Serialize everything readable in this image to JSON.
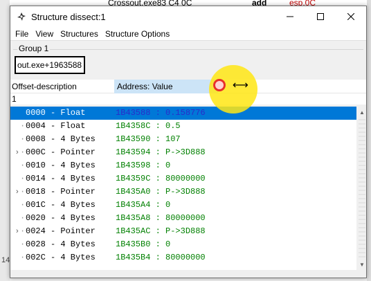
{
  "background": {
    "top_text_1": "Crossout.exe83 C4 0C",
    "top_text_2": "add",
    "top_text_3": "esp,0C",
    "left_text": "14"
  },
  "window": {
    "title": "Structure dissect:1",
    "icon": "cheat-engine-icon",
    "minimize_icon": "minimize-icon",
    "maximize_icon": "maximize-icon",
    "close_icon": "close-icon"
  },
  "menu": {
    "items": [
      "File",
      "View",
      "Structures",
      "Structure Options"
    ]
  },
  "group": {
    "label": "Group 1",
    "address": "out.exe+1963588"
  },
  "header": {
    "offset_description": "Offset-description",
    "address_value": "Address: Value"
  },
  "subheader": {
    "text": "1"
  },
  "rows": [
    {
      "desc": "0000 - Float",
      "value": "1B43588 : 0.158776",
      "expandable": false,
      "selected": true
    },
    {
      "desc": "0004 - Float",
      "value": "1B4358C : 0.5",
      "expandable": false,
      "selected": false
    },
    {
      "desc": "0008 - 4 Bytes",
      "value": "1B43590 : 107",
      "expandable": false,
      "selected": false
    },
    {
      "desc": "000C - Pointer",
      "value": "1B43594 : P->3D888",
      "expandable": true,
      "selected": false
    },
    {
      "desc": "0010 - 4 Bytes",
      "value": "1B43598 : 0",
      "expandable": false,
      "selected": false
    },
    {
      "desc": "0014 - 4 Bytes",
      "value": "1B4359C : 80000000",
      "expandable": false,
      "selected": false
    },
    {
      "desc": "0018 - Pointer",
      "value": "1B435A0 : P->3D888",
      "expandable": true,
      "selected": false
    },
    {
      "desc": "001C - 4 Bytes",
      "value": "1B435A4 : 0",
      "expandable": false,
      "selected": false
    },
    {
      "desc": "0020 - 4 Bytes",
      "value": "1B435A8 : 80000000",
      "expandable": false,
      "selected": false
    },
    {
      "desc": "0024 - Pointer",
      "value": "1B435AC : P->3D888",
      "expandable": true,
      "selected": false
    },
    {
      "desc": "0028 - 4 Bytes",
      "value": "1B435B0 : 0",
      "expandable": false,
      "selected": false
    },
    {
      "desc": "002C - 4 Bytes",
      "value": "1B435B4 : 80000000",
      "expandable": false,
      "selected": false
    }
  ],
  "colors": {
    "selection": "#0078d7",
    "value_text": "#008000",
    "header_highlight": "#cce4f7",
    "cursor_halo": "#ffe614"
  }
}
